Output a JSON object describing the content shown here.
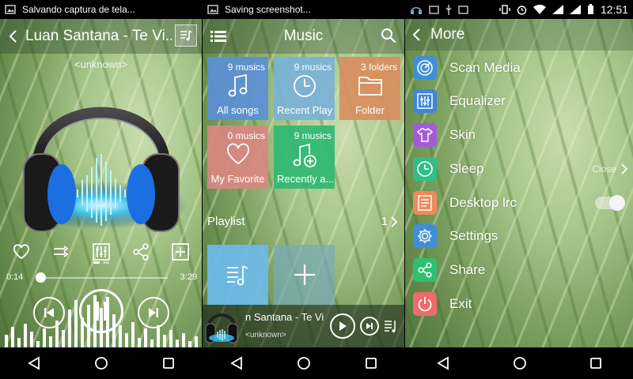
{
  "left_panel": {
    "status_text": "Salvando captura de tela...",
    "title": "Luan Santana - Te Vi...",
    "artist": "<unknown>",
    "time_current": "0:14",
    "time_total": "3:29",
    "progress": 0.067,
    "icons": [
      "back-arrow-icon",
      "queue-music-icon",
      "heart-icon",
      "shuffle-icon",
      "equalizer-icon",
      "share-icon",
      "add-box-icon",
      "previous-icon",
      "pause-icon",
      "next-icon"
    ]
  },
  "middle_panel": {
    "status_text": "Saving screenshot...",
    "title": "Music",
    "tiles": [
      {
        "count": "9 musics",
        "label": "All songs",
        "color": "#5b8fd6"
      },
      {
        "count": "9 musics",
        "label": "Recent Play",
        "color": "#7ab2d6"
      },
      {
        "count": "3 folders",
        "label": "Folder",
        "color": "#d98d5e"
      },
      {
        "count": "0 musics",
        "label": "My Favorite",
        "color": "#d98780"
      },
      {
        "count": "9 musics",
        "label": "Recently a...",
        "color": "#2fb872"
      }
    ],
    "playlist_label": "Playlist",
    "playlist_count": "1",
    "mini_player": {
      "title": "n Santana - Te Vi",
      "artist": "<unknown>"
    }
  },
  "right_panel": {
    "clock": "12:51",
    "title": "More",
    "menu": [
      {
        "label": "Scan Media",
        "icon": "scan-media-icon",
        "color": "#3f8fd8"
      },
      {
        "label": "Equalizer",
        "icon": "equalizer-icon",
        "color": "#3f86d8"
      },
      {
        "label": "Skin",
        "icon": "shirt-icon",
        "color": "#a55bd6"
      },
      {
        "label": "Sleep",
        "icon": "clock-icon",
        "color": "#2fbf87",
        "value": "Close"
      },
      {
        "label": "Desktop lrc",
        "icon": "lyrics-icon",
        "color": "#ef8a5b",
        "toggle": true
      },
      {
        "label": "Settings",
        "icon": "gear-icon",
        "color": "#3f8fd8"
      },
      {
        "label": "Share",
        "icon": "share-icon",
        "color": "#2fc06f"
      },
      {
        "label": "Exit",
        "icon": "power-icon",
        "color": "#ef6b6b"
      }
    ]
  }
}
